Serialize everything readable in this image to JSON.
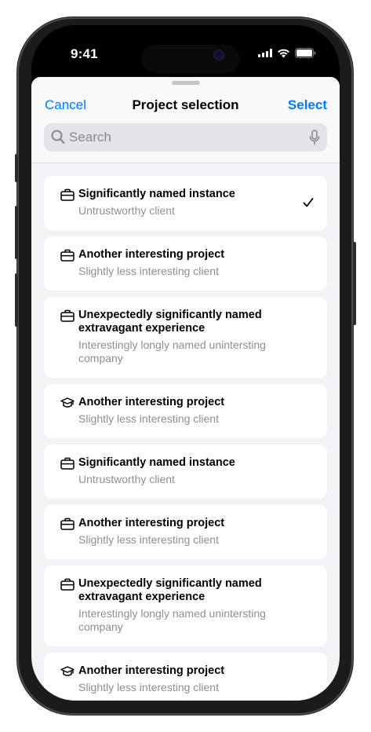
{
  "status_bar": {
    "time": "9:41"
  },
  "nav": {
    "cancel_label": "Cancel",
    "title": "Project selection",
    "select_label": "Select"
  },
  "search": {
    "placeholder": "Search",
    "value": ""
  },
  "colors": {
    "accent": "#007aff",
    "secondary_text": "#8e8e93",
    "sheet_bg": "#f2f2f7"
  },
  "projects": [
    {
      "title": "Significantly named instance",
      "client": "Untrustworthy client",
      "icon": "briefcase-icon",
      "selected": true
    },
    {
      "title": "Another interesting project",
      "client": "Slightly less interesting client",
      "icon": "briefcase-icon",
      "selected": false
    },
    {
      "title": "Unexpectedly significantly named extravagant experience",
      "client": "Interestingly longly named unintersting company",
      "icon": "briefcase-icon",
      "selected": false
    },
    {
      "title": "Another interesting project",
      "client": "Slightly less interesting client",
      "icon": "graduation-cap-icon",
      "selected": false
    },
    {
      "title": "Significantly named instance",
      "client": "Untrustworthy client",
      "icon": "briefcase-icon",
      "selected": false
    },
    {
      "title": "Another interesting project",
      "client": "Slightly less interesting client",
      "icon": "briefcase-icon",
      "selected": false
    },
    {
      "title": "Unexpectedly significantly named extravagant experience",
      "client": "Interestingly longly named unintersting company",
      "icon": "briefcase-icon",
      "selected": false
    },
    {
      "title": "Another interesting project",
      "client": "Slightly less interesting client",
      "icon": "graduation-cap-icon",
      "selected": false
    }
  ]
}
